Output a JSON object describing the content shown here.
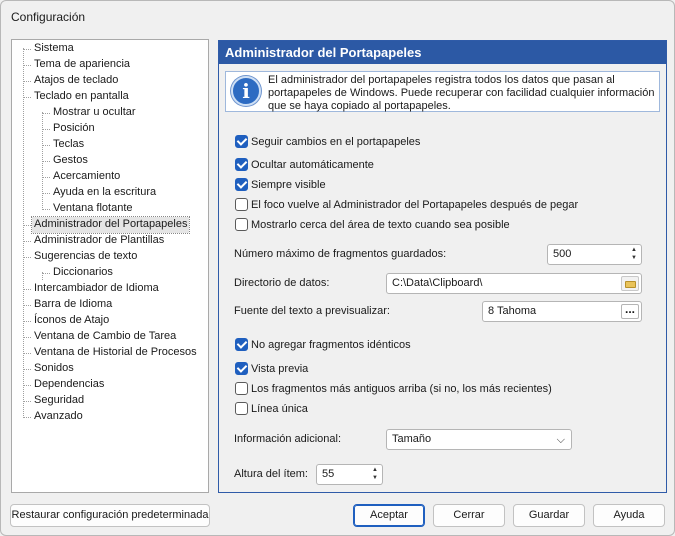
{
  "window": {
    "title": "Configuración"
  },
  "tree": {
    "items": [
      "Sistema",
      "Tema de apariencia",
      "Atajos de teclado",
      "Teclado en pantalla",
      "Mostrar u ocultar",
      "Posición",
      "Teclas",
      "Gestos",
      "Acercamiento",
      "Ayuda en la escritura",
      "Ventana flotante",
      "Administrador del Portapapeles",
      "Administrador de Plantillas",
      "Sugerencias de texto",
      "Diccionarios",
      "Intercambiador de Idioma",
      "Barra de Idioma",
      "Íconos de Atajo",
      "Ventana de Cambio de Tarea",
      "Ventana de Historial de Procesos",
      "Sonidos",
      "Dependencias",
      "Seguridad",
      "Avanzado"
    ],
    "selected": "Administrador del Portapapeles"
  },
  "panel": {
    "header": "Administrador del Portapapeles",
    "info": "El administrador del portapapeles registra todos los datos que pasan al portapapeles de Windows. Puede recuperar con facilidad cualquier información que se haya copiado al portapapeles.",
    "options": {
      "track_changes": "Seguir cambios en el portapapeles",
      "auto_hide": "Ocultar automáticamente",
      "always_visible": "Siempre visible",
      "focus_return": "El foco vuelve al Administrador del Portapapeles después de pegar",
      "show_near_text": "Mostrarlo cerca del área de texto cuando sea posible",
      "no_duplicates": "No agregar fragmentos idénticos",
      "preview": "Vista previa",
      "oldest_on_top": "Los fragmentos más antiguos arriba (si no, los más recientes)",
      "single_line": "Línea única"
    },
    "max_fragments": {
      "label": "Número máximo de fragmentos guardados:",
      "value": "500"
    },
    "data_dir": {
      "label": "Directorio de datos:",
      "value": "C:\\Data\\Clipboard\\"
    },
    "preview_font": {
      "label": "Fuente del texto a previsualizar:",
      "value": "8 Tahoma"
    },
    "additional_info": {
      "label": "Información adicional:",
      "value": "Tamaño"
    },
    "item_height": {
      "label": "Altura del ítem:",
      "value": "55"
    }
  },
  "buttons": {
    "restore": "Restaurar configuración predeterminada",
    "accept": "Aceptar",
    "close": "Cerrar",
    "save": "Guardar",
    "help": "Ayuda"
  },
  "colors": {
    "accent": "#2c59a5",
    "checkbox": "#1f5fbf"
  }
}
